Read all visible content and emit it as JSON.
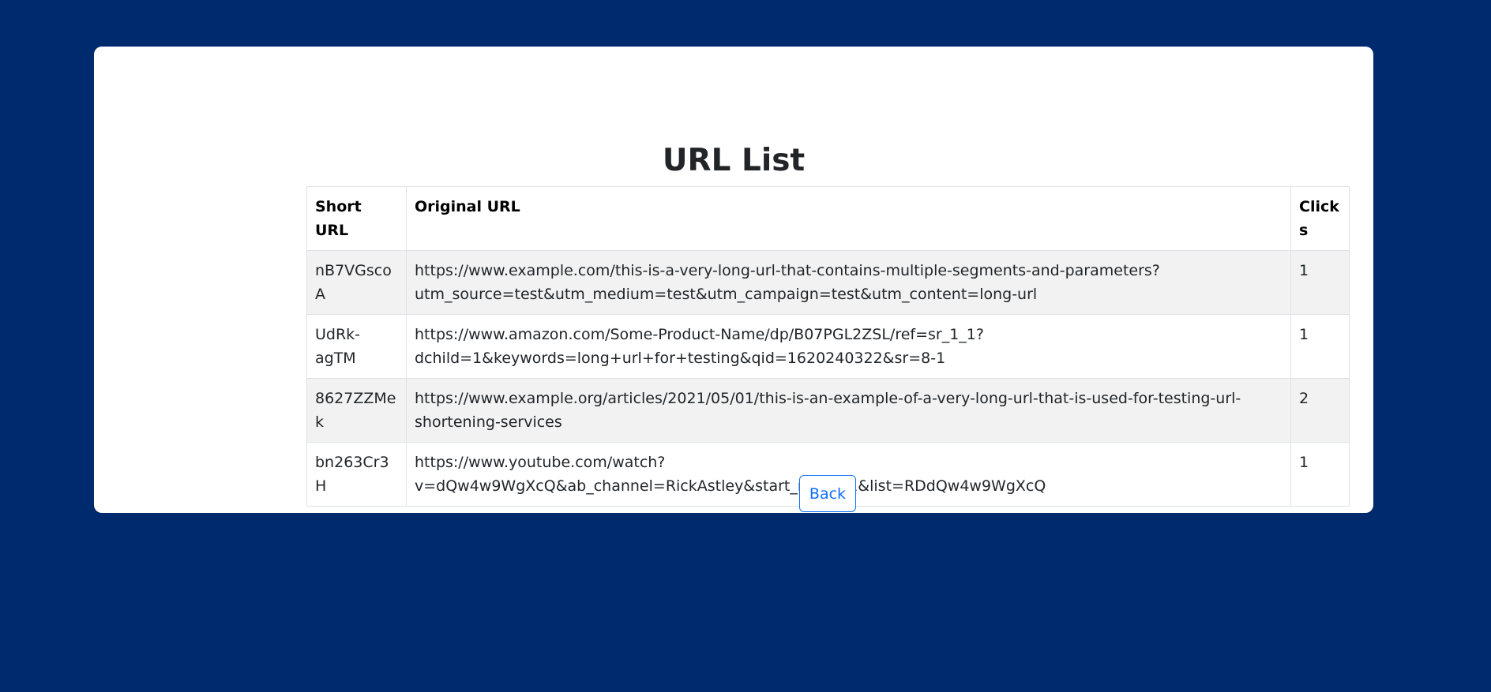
{
  "page": {
    "title": "URL List"
  },
  "table": {
    "headers": {
      "short_url": "Short URL",
      "original_url": "Original URL",
      "clicks": "Clicks"
    },
    "rows": [
      {
        "short_url": "nB7VGscoA",
        "original_url": "https://www.example.com/this-is-a-very-long-url-that-contains-multiple-segments-and-parameters?utm_source=test&utm_medium=test&utm_campaign=test&utm_content=long-url",
        "clicks": "1"
      },
      {
        "short_url": "UdRk-agTM",
        "original_url": "https://www.amazon.com/Some-Product-Name/dp/B07PGL2ZSL/ref=sr_1_1?dchild=1&keywords=long+url+for+testing&qid=1620240322&sr=8-1",
        "clicks": "1"
      },
      {
        "short_url": "8627ZZMek",
        "original_url": "https://www.example.org/articles/2021/05/01/this-is-an-example-of-a-very-long-url-that-is-used-for-testing-url-shortening-services",
        "clicks": "2"
      },
      {
        "short_url": "bn263Cr3H",
        "original_url": "https://www.youtube.com/watch?v=dQw4w9WgXcQ&ab_channel=RickAstley&start_radio=1&list=RDdQw4w9WgXcQ",
        "clicks": "1"
      }
    ]
  },
  "actions": {
    "back_label": "Back"
  },
  "colors": {
    "background": "#002a6e",
    "card": "#ffffff",
    "accent": "#0d6efd",
    "stripe": "#f2f2f2"
  }
}
